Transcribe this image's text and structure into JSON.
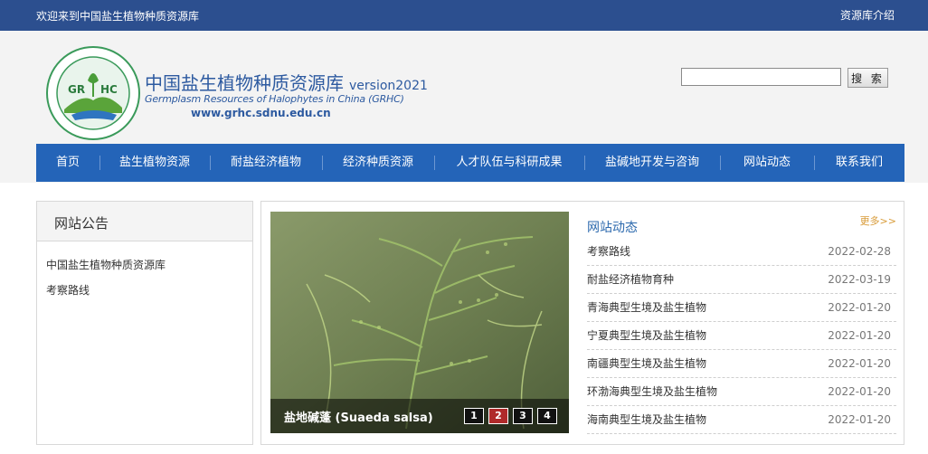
{
  "topbar": {
    "welcome": "欢迎来到中国盐生植物种质资源库",
    "intro_link": "资源库介绍"
  },
  "brand": {
    "title": "中国盐生植物种质资源库",
    "version": "version2021",
    "english": "Germplasm Resources of Halophytes in China (GRHC)",
    "url": "www.grhc.sdnu.edu.cn",
    "logo_letters_left": "GR",
    "logo_letters_right": "HC"
  },
  "search": {
    "value": "",
    "button_label": "搜 索"
  },
  "nav": {
    "items": [
      "首页",
      "盐生植物资源",
      "耐盐经济植物",
      "经济种质资源",
      "人才队伍与科研成果",
      "盐碱地开发与咨询",
      "网站动态",
      "联系我们"
    ]
  },
  "notice": {
    "title": "网站公告",
    "items": [
      "中国盐生植物种质资源库",
      "考察路线"
    ]
  },
  "slideshow": {
    "caption": "盐地碱蓬 (Suaeda salsa)",
    "pages": [
      "1",
      "2",
      "3",
      "4"
    ],
    "active_page": "2"
  },
  "news": {
    "title": "网站动态",
    "more_label": "更多>>",
    "items": [
      {
        "title": "考察路线",
        "date": "2022-02-28"
      },
      {
        "title": "耐盐经济植物育种",
        "date": "2022-03-19"
      },
      {
        "title": "青海典型生境及盐生植物",
        "date": "2022-01-20"
      },
      {
        "title": "宁夏典型生境及盐生植物",
        "date": "2022-01-20"
      },
      {
        "title": "南疆典型生境及盐生植物",
        "date": "2022-01-20"
      },
      {
        "title": "环渤海典型生境及盐生植物",
        "date": "2022-01-20"
      },
      {
        "title": "海南典型生境及盐生植物",
        "date": "2022-01-20"
      }
    ]
  },
  "colors": {
    "topbar": "#2c4f8f",
    "nav": "#2464b8",
    "brand_text": "#2d5aa0",
    "more_link": "#d89b38",
    "active_dot": "#b02a2a"
  }
}
